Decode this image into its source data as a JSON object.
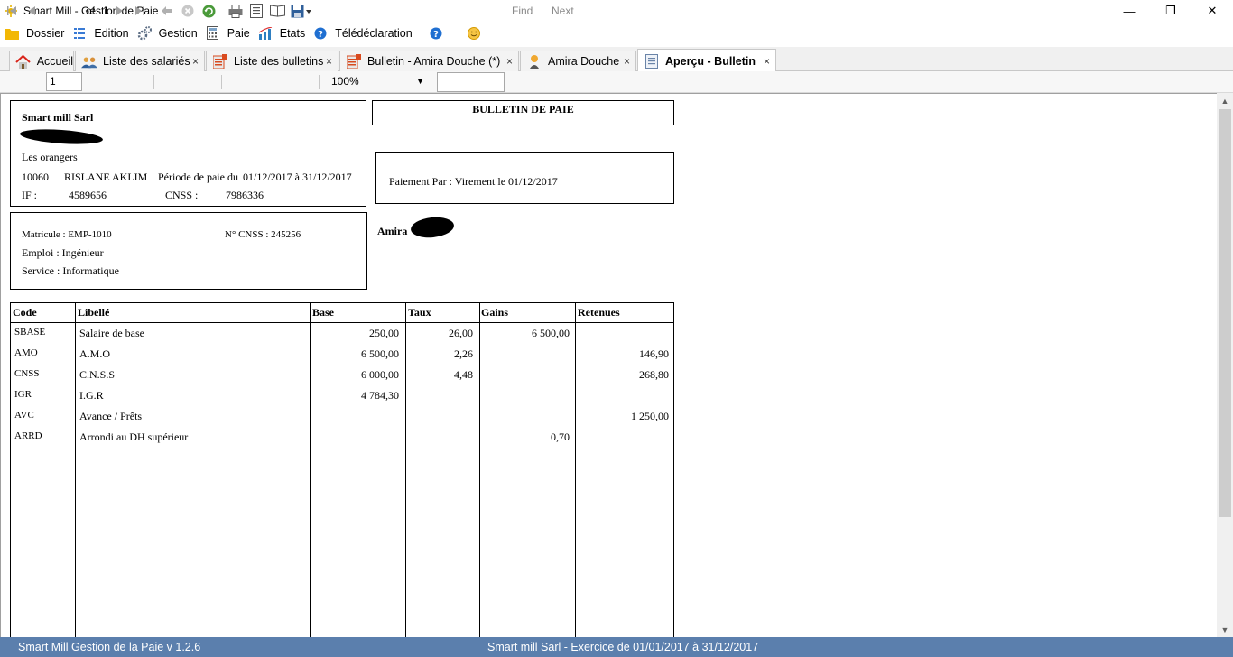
{
  "window": {
    "title": "Smart Mill - Gestion de Paie",
    "minimize": "—",
    "restore": "❐",
    "close": "✕"
  },
  "menu": [
    {
      "label": "Dossier",
      "icon": "folder-icon"
    },
    {
      "label": "Edition",
      "icon": "list-icon"
    },
    {
      "label": "Gestion",
      "icon": "gears-icon"
    },
    {
      "label": "Paie",
      "icon": "calculator-icon"
    },
    {
      "label": "Etats",
      "icon": "chart-icon"
    },
    {
      "label": "Télédéclaration",
      "icon": "help-circle-icon"
    },
    {
      "label": "",
      "icon": "help-circle-icon"
    },
    {
      "label": "",
      "icon": "smiley-icon"
    }
  ],
  "tabs": [
    {
      "label": "Accueil",
      "icon": "home-icon",
      "close": "×"
    },
    {
      "label": "Liste des salariés",
      "icon": "users-icon",
      "close": "×"
    },
    {
      "label": "Liste des bulletins",
      "icon": "sheet-icon",
      "close": "×"
    },
    {
      "label": "Bulletin - Amira Douche (*)",
      "icon": "sheet-icon",
      "close": "×"
    },
    {
      "label": "Amira Douche",
      "icon": "person-icon",
      "close": "×"
    },
    {
      "label": "Aperçu - Bulletin",
      "icon": "document-icon",
      "close": "×",
      "active": true
    }
  ],
  "toolbar": {
    "page_value": "1",
    "of_label": "of",
    "total_pages": "1",
    "zoom": "100%",
    "find_label": "Find",
    "next_label": "Next",
    "find_value": ""
  },
  "payslip": {
    "company_name": "Smart mill Sarl",
    "address": "Les orangers",
    "company_code": "10060",
    "company_city": "RISLANE AKLIM",
    "period_label": "Période de paie du",
    "period_value": "01/12/2017 à 31/12/2017",
    "if_label": "IF :",
    "if_value": "4589656",
    "cnss_label": "CNSS :",
    "cnss_value": "7986336",
    "title": "BULLETIN DE PAIE",
    "payment": "Paiement Par :  Virement  le  01/12/2017",
    "matricule": "Matricule : EMP-1010",
    "ncnss": "N° CNSS : 245256",
    "emploi": "Emploi : Ingénieur",
    "service": "Service : Informatique",
    "employee_first_name": "Amira"
  },
  "table": {
    "headers": [
      "Code",
      "Libellé",
      "Base",
      "Taux",
      "Gains",
      "Retenues"
    ],
    "rows": [
      {
        "code": "SBASE",
        "label": "Salaire de base",
        "base": "250,00",
        "taux": "26,00",
        "gains": "6 500,00",
        "retenues": ""
      },
      {
        "code": "AMO",
        "label": "A.M.O",
        "base": "6 500,00",
        "taux": "2,26",
        "gains": "",
        "retenues": "146,90"
      },
      {
        "code": "CNSS",
        "label": "C.N.S.S",
        "base": "6 000,00",
        "taux": "4,48",
        "gains": "",
        "retenues": "268,80"
      },
      {
        "code": "IGR",
        "label": "I.G.R",
        "base": "4 784,30",
        "taux": "",
        "gains": "",
        "retenues": ""
      },
      {
        "code": "AVC",
        "label": "Avance / Prêts",
        "base": "",
        "taux": "",
        "gains": "",
        "retenues": "1 250,00"
      },
      {
        "code": "ARRD",
        "label": "Arrondi au DH supérieur",
        "base": "",
        "taux": "",
        "gains": "0,70",
        "retenues": ""
      }
    ]
  },
  "status": {
    "left": "Smart Mill Gestion de la Paie v 1.2.6",
    "center": "Smart mill Sarl - Exercice de 01/01/2017 à 31/12/2017"
  },
  "colors": {
    "statusbar": "#5b7fad",
    "tab_active_bg": "#ffffff",
    "tabbar_bg": "#f0f0f0"
  }
}
